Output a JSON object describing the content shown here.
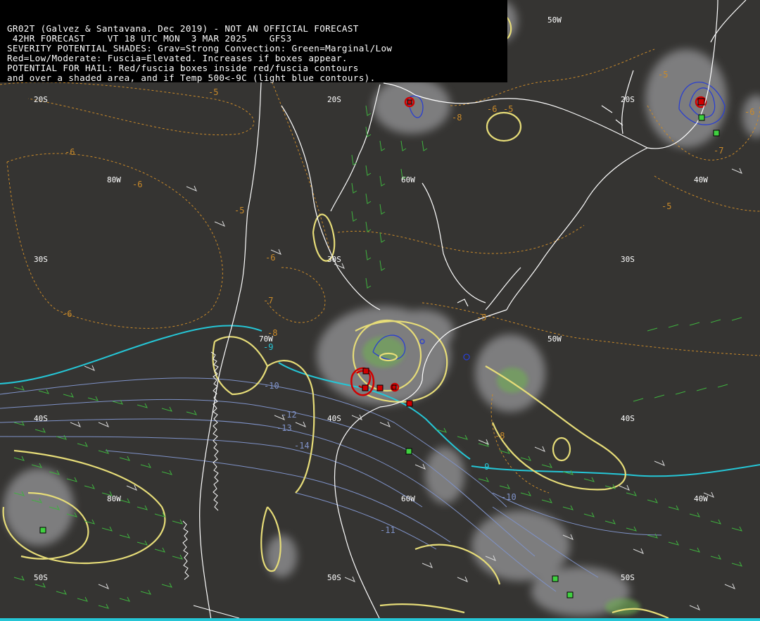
{
  "header": {
    "line1": "GR02T (Galvez & Santavana. Dec 2019) - NOT AN OFFICIAL FORECAST",
    "line2": " 42HR FORECAST    VT 18 UTC MON  3 MAR 2025    GFS3",
    "line3": "SEVERITY POTENTIAL SHADES: Grav=Strong Convection: Green=Marginal/Low",
    "line4": "Red=Low/Moderate: Fuscia=Elevated. Increases if boxes appear.",
    "line5": "POTENTIAL FOR HAIL: Red/fuscia boxes inside red/fuscia contours",
    "line6": "and over a shaded area, and if Temp 500<-9C (light blue contours)."
  },
  "grid_labels": {
    "lat_20S_a": "20S",
    "lat_20S_b": "20S",
    "lat_20S_c": "20S",
    "lat_30S_a": "30S",
    "lat_30S_b": "30S",
    "lat_30S_c": "30S",
    "lat_40S_a": "40S",
    "lat_40S_b": "40S",
    "lat_40S_c": "40S",
    "lat_50S_a": "50S",
    "lat_50S_b": "50S",
    "lat_50S_c": "50S",
    "lon_80W_a": "80W",
    "lon_80W_b": "80W",
    "lon_70W": "70W",
    "lon_60W_a": "60W",
    "lon_60W_b": "60W",
    "lon_50W_a": "50W",
    "lon_50W_b": "50W",
    "lon_40W_a": "40W",
    "lon_40W_b": "40W"
  },
  "temperature_labels": {
    "m5_a": "-5",
    "m5_b": "-5",
    "m5_c": "-5",
    "m5_d": "-5",
    "m5_e": "-5",
    "m5_f": "-5",
    "m6_a": "-6",
    "m6_b": "-6",
    "m6_c": "-6",
    "m6_d": "-6",
    "m6_e": "-6",
    "m6_f": "-6",
    "m7_a": "-7",
    "m7_b": "-7",
    "m8_a": "-8",
    "m8_b": "-8",
    "m8_c": "-8",
    "m9_a": "-9",
    "m9_b": "-9",
    "m10_a": "-10",
    "m10_b": "-10",
    "m11": "-11",
    "m12": "-12",
    "m13": "-13",
    "m14": "-14"
  },
  "colors": {
    "background": "#353432",
    "land_outline": "#ffffff",
    "temp_dashed": "#c98a2a",
    "cold_500": "#25c6d6",
    "cold_lines": "#7f92c8",
    "convection_contour": "#e6dc78",
    "wind_barbs": "#3fb23f",
    "hail_box_red": "#d00000",
    "hail_box_green": "#40d040"
  },
  "icons": [
    "wind-barb-icon",
    "hail-box-icon",
    "low-pressure-marker-icon"
  ]
}
